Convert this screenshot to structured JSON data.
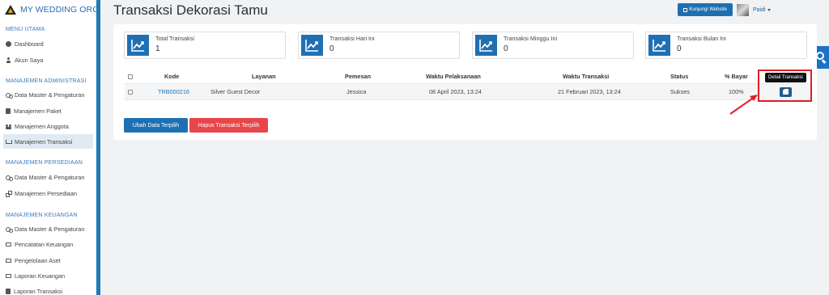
{
  "colors": {
    "accent": "#1f70b3",
    "danger": "#e8464a",
    "highlight": "#e01f26",
    "sidebar_strip": "#1e7ab8"
  },
  "brand": {
    "name": "MY WEDDING ORGAN"
  },
  "sidebar": {
    "sections": [
      {
        "label": "MENU UTAMA",
        "items": [
          {
            "label": "Dashboard",
            "icon": "dashboard-icon"
          },
          {
            "label": "Akun Saya",
            "icon": "user-icon"
          }
        ]
      },
      {
        "label": "MANAJEMEN ADMINISTRASI",
        "items": [
          {
            "label": "Data Master & Pengaturan",
            "icon": "cogs-icon"
          },
          {
            "label": "Manajemen Paket",
            "icon": "book-icon"
          },
          {
            "label": "Manajemen Anggota",
            "icon": "users-icon"
          },
          {
            "label": "Manajemen Transaksi",
            "icon": "cart-icon",
            "active": true
          }
        ]
      },
      {
        "label": "MANAJEMEN PERSEDIAAN",
        "items": [
          {
            "label": "Data Master & Pengaturan",
            "icon": "cogs-icon"
          },
          {
            "label": "Manajemen Persediaan",
            "icon": "cubes-icon"
          }
        ]
      },
      {
        "label": "MANAJEMEN KEUANGAN",
        "items": [
          {
            "label": "Data Master & Pengaturan",
            "icon": "cogs-icon"
          },
          {
            "label": "Pencatatan Keuangan",
            "icon": "money-icon"
          },
          {
            "label": "Pengelolaan Aset",
            "icon": "building-icon"
          },
          {
            "label": "Laporan Keuangan",
            "icon": "money-icon"
          },
          {
            "label": "Laporan Transaksi",
            "icon": "book-icon"
          }
        ]
      }
    ]
  },
  "header": {
    "title": "Transaksi Dekorasi Tamu",
    "visit_button": "Kunjungi Website",
    "user_name": "Paidi"
  },
  "stats": [
    {
      "title": "Total Transaksi",
      "value": "1"
    },
    {
      "title": "Transaksi Hari Ini",
      "value": "0"
    },
    {
      "title": "Transaksi Minggu Ini",
      "value": "0"
    },
    {
      "title": "Transaksi Bulan Ini",
      "value": "0"
    }
  ],
  "table": {
    "headers": {
      "kode": "Kode",
      "layanan": "Layanan",
      "pemesan": "Pemesan",
      "waktu_pelaksanaan": "Waktu Pelaksanaan",
      "waktu_transaksi": "Waktu Transaksi",
      "status": "Status",
      "bayar": "% Bayar"
    },
    "rows": [
      {
        "kode": "TRB000216",
        "layanan": "Silver Guest Decor",
        "pemesan": "Jessica",
        "waktu_pelaksanaan": "08 April 2023, 13:24",
        "waktu_transaksi": "21 Februari 2023, 13:24",
        "status": "Sukses",
        "bayar": "100%"
      }
    ]
  },
  "tooltip": "Detail Transaksi",
  "actions": {
    "edit_selected": "Ubah Data Terpilih",
    "delete_selected": "Hapus Transaksi Terpilih"
  }
}
